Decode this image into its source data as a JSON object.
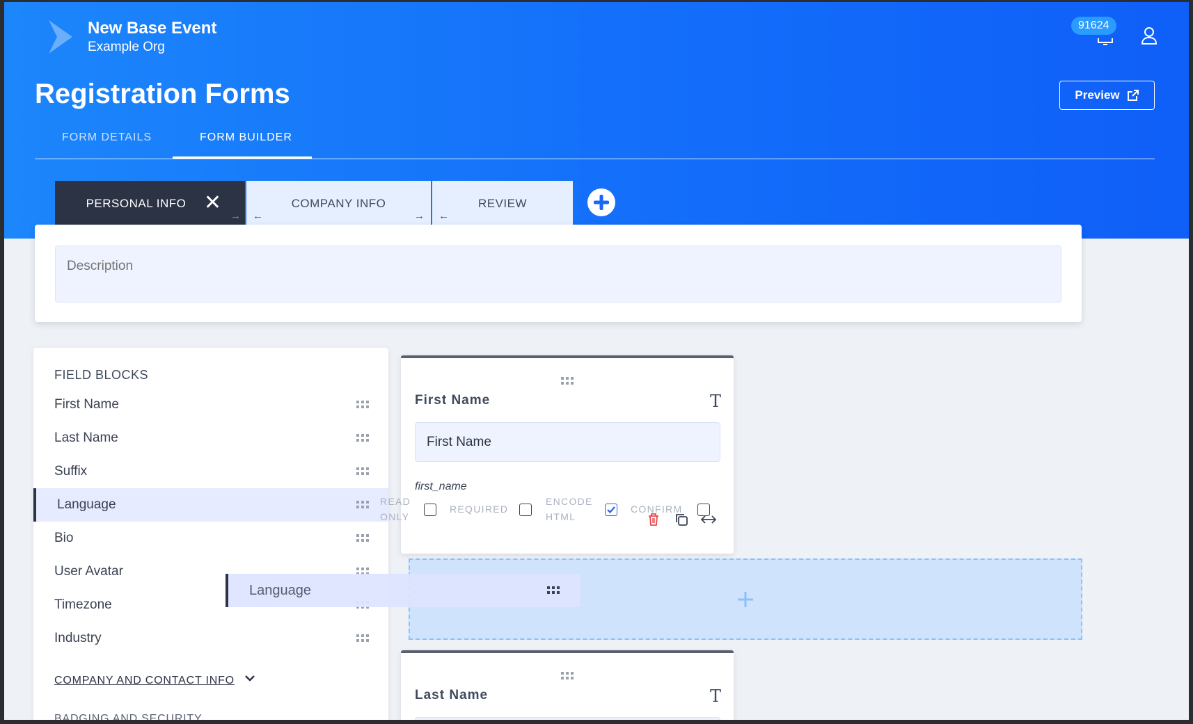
{
  "header": {
    "app_title": "New Base Event",
    "app_subtitle": "Example Org",
    "notification_count": "91624"
  },
  "page": {
    "title": "Registration Forms",
    "preview_label": "Preview"
  },
  "tabs": [
    {
      "label": "FORM DETAILS",
      "active": false
    },
    {
      "label": "FORM BUILDER",
      "active": true
    }
  ],
  "steps": [
    {
      "label": "PERSONAL INFO",
      "active": true
    },
    {
      "label": "COMPANY INFO",
      "active": false
    },
    {
      "label": "REVIEW",
      "active": false
    }
  ],
  "description": {
    "placeholder": "Description"
  },
  "field_blocks": {
    "heading": "FIELD BLOCKS",
    "items": [
      {
        "label": "First Name"
      },
      {
        "label": "Last Name"
      },
      {
        "label": "Suffix"
      },
      {
        "label": "Language",
        "highlighted": true
      },
      {
        "label": "Bio"
      },
      {
        "label": "User Avatar"
      },
      {
        "label": "Timezone"
      },
      {
        "label": "Industry"
      }
    ],
    "section_link": "COMPANY AND CONTACT INFO",
    "next_section": "BADGING AND SECURITY"
  },
  "drag_ghost": {
    "label": "Language"
  },
  "form_fields": [
    {
      "label": "First Name",
      "input_value": "First Name",
      "key": "first_name",
      "options": {
        "read_only_line1": "READ",
        "read_only_line2": "ONLY",
        "required": "REQUIRED",
        "encode_html_line1": "ENCODE",
        "encode_html_line2": "HTML",
        "confirm": "CONFIRM"
      },
      "read_only": false,
      "required": false,
      "encode_html": true,
      "confirm_checked": false
    },
    {
      "label": "Last Name"
    }
  ],
  "colors": {
    "brand_blue": "#1470fa",
    "step_active": "#2b3344",
    "delete_red": "#e5484d"
  }
}
